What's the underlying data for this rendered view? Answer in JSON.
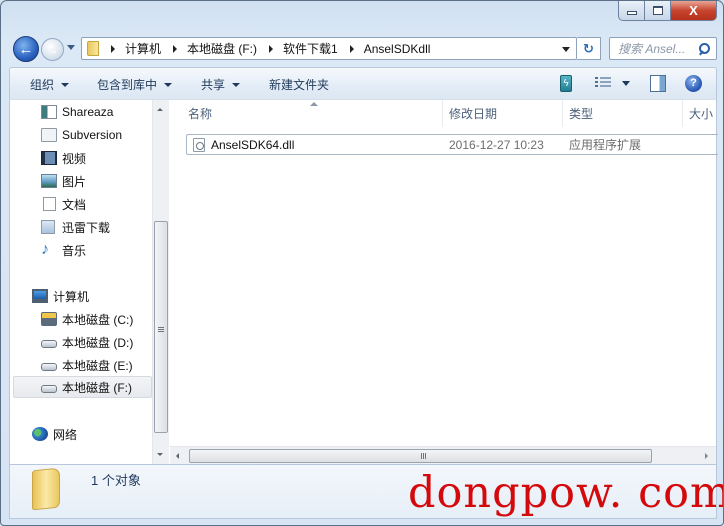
{
  "window": {
    "caption_buttons": {
      "minimize": "minimize",
      "maximize": "maximize",
      "close": "X"
    }
  },
  "nav": {
    "back_icon": "←",
    "forward_icon": "→",
    "breadcrumbs": [
      "计算机",
      "本地磁盘 (F:)",
      "软件下载1",
      "AnselSDKdll"
    ],
    "refresh_icon": "↻",
    "search_placeholder": "搜索 Ansel..."
  },
  "toolbar": {
    "organize": "组织",
    "include_in_library": "包含到库中",
    "share": "共享",
    "new_folder": "新建文件夹",
    "mobile_icon_glyph": "ϟ",
    "help_glyph": "?"
  },
  "sidebar": {
    "items": [
      {
        "label": "Shareaza",
        "icon": "shareaza-icon"
      },
      {
        "label": "Subversion",
        "icon": "subversion-icon"
      },
      {
        "label": "视频",
        "icon": "video-icon"
      },
      {
        "label": "图片",
        "icon": "picture-icon"
      },
      {
        "label": "文档",
        "icon": "document-icon"
      },
      {
        "label": "迅雷下载",
        "icon": "thunder-download-icon"
      },
      {
        "label": "音乐",
        "icon": "music-icon"
      }
    ],
    "computer": {
      "label": "计算机",
      "drives": [
        {
          "label": "本地磁盘 (C:)"
        },
        {
          "label": "本地磁盘 (D:)"
        },
        {
          "label": "本地磁盘 (E:)"
        },
        {
          "label": "本地磁盘 (F:)",
          "selected": true
        }
      ]
    },
    "network": {
      "label": "网络"
    },
    "music_glyph": "♪"
  },
  "file_list": {
    "columns": [
      "名称",
      "修改日期",
      "类型",
      "大小"
    ],
    "rows": [
      {
        "name": "AnselSDK64.dll",
        "modified": "2016-12-27 10:23",
        "type": "应用程序扩展",
        "size": ""
      }
    ]
  },
  "details": {
    "count": "1 个对象"
  },
  "watermark": "dongpow. com",
  "colors": {
    "watermark": "#d4090b",
    "accent": "#1e395b"
  }
}
